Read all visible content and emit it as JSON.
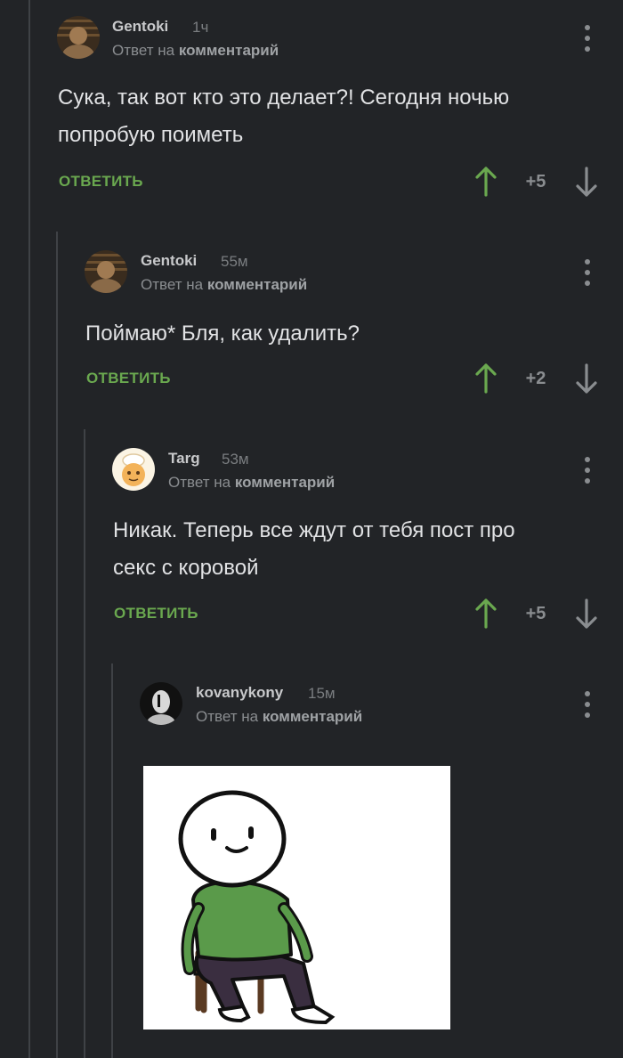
{
  "comments": [
    {
      "author": "Gentoki",
      "time": "1ч",
      "reply_prefix": "Ответ на",
      "reply_target": "комментарий",
      "text_lines": [
        "Сука, так вот кто это делает?! Сегодня ночью",
        "попробую поиметь"
      ],
      "reply_label": "ОТВЕТИТЬ",
      "score": "+5"
    },
    {
      "author": "Gentoki",
      "time": "55м",
      "reply_prefix": "Ответ на",
      "reply_target": "комментарий",
      "text_lines": [
        "Поймаю* Бля, как удалить?"
      ],
      "reply_label": "ОТВЕТИТЬ",
      "score": "+2"
    },
    {
      "author": "Targ",
      "time": "53м",
      "reply_prefix": "Ответ на",
      "reply_target": "комментарий",
      "text_lines": [
        "Никак. Теперь все ждут от тебя пост про",
        "секс с коровой"
      ],
      "reply_label": "ОТВЕТИТЬ",
      "score": "+5"
    },
    {
      "author": "kovanykony",
      "time": "15м",
      "reply_prefix": "Ответ на",
      "reply_target": "комментарий"
    }
  ],
  "icons": {
    "upvote": "arrow-up-icon",
    "downvote": "arrow-down-icon",
    "menu": "more-vertical-icon"
  },
  "colors": {
    "background": "#222427",
    "accent_green": "#6aa84f",
    "text": "#e1e2e4",
    "muted": "#8a8d90"
  }
}
